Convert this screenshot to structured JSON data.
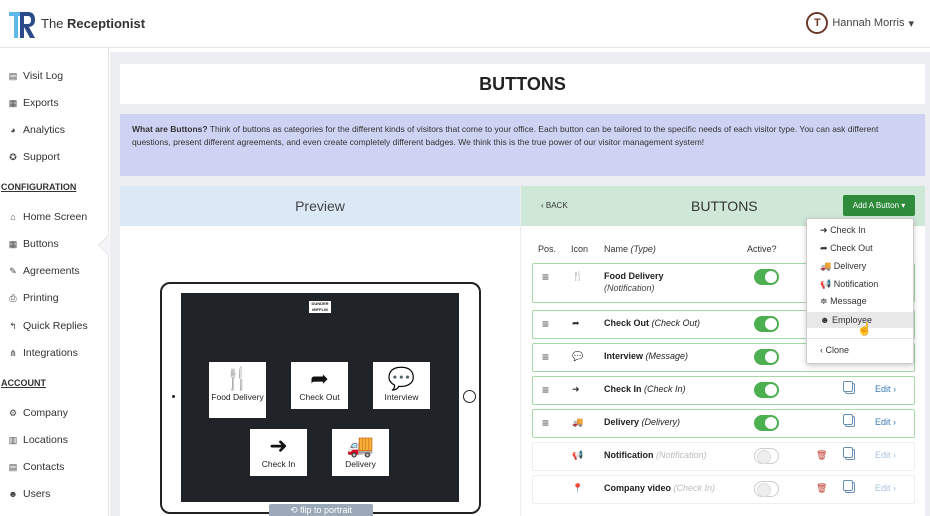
{
  "app": {
    "brand_light": "The ",
    "brand_bold": "Receptionist",
    "logo_letters": "R"
  },
  "user": {
    "name": "Hannah Morris",
    "avatar_initials": "T",
    "caret": "▾"
  },
  "sidebar": {
    "items": [
      {
        "icon": "file-icon",
        "glyph": "▤",
        "label": "Visit Log"
      },
      {
        "icon": "calendar-icon",
        "glyph": "▦",
        "label": "Exports"
      },
      {
        "icon": "tachometer-icon",
        "glyph": "◕",
        "label": "Analytics"
      },
      {
        "icon": "lifebuoy-icon",
        "glyph": "✪",
        "label": "Support"
      }
    ],
    "config_heading": "CONFIGURATION",
    "config_items": [
      {
        "icon": "home-icon",
        "glyph": "⌂",
        "label": "Home Screen"
      },
      {
        "icon": "th-large-icon",
        "glyph": "▦",
        "label": "Buttons"
      },
      {
        "icon": "clipboard-icon",
        "glyph": "✎",
        "label": "Agreements"
      },
      {
        "icon": "print-icon",
        "glyph": "⎙",
        "label": "Printing"
      },
      {
        "icon": "reply-icon",
        "glyph": "↰",
        "label": "Quick Replies"
      },
      {
        "icon": "sitemap-icon",
        "glyph": "⋔",
        "label": "Integrations"
      }
    ],
    "account_heading": "ACCOUNT",
    "account_items": [
      {
        "icon": "cog-icon",
        "glyph": "⚙",
        "label": "Company"
      },
      {
        "icon": "building-icon",
        "glyph": "▥",
        "label": "Locations"
      },
      {
        "icon": "address-book-icon",
        "glyph": "▤",
        "label": "Contacts"
      },
      {
        "icon": "users-icon",
        "glyph": "☻",
        "label": "Users"
      }
    ]
  },
  "page": {
    "title": "BUTTONS",
    "info_bold": "What are Buttons?",
    "info_text": " Think of buttons as categories for the different kinds of visitors that come to your office. Each button can be tailored to the specific needs of each visitor type. You can ask different questions, present different agreements, and even create completely different badges. We think this is the true power of our visitor management system!"
  },
  "preview": {
    "heading": "Preview",
    "logo_text": "DUNDER MIFFLIN",
    "buttons": [
      {
        "icon": "cutlery-icon",
        "glyph": "🍴",
        "label": "Food Delivery"
      },
      {
        "icon": "sign-out-icon",
        "glyph": "➦",
        "label": "Check Out"
      },
      {
        "icon": "comments-icon",
        "glyph": "💬",
        "label": "Interview"
      },
      {
        "icon": "sign-in-icon",
        "glyph": "➜",
        "label": "Check In"
      },
      {
        "icon": "truck-icon",
        "glyph": "🚚",
        "label": "Delivery"
      }
    ],
    "flip_label": "⟲ flip to portrait"
  },
  "buttons_panel": {
    "back_label": "‹ BACK",
    "title": "BUTTONS",
    "add_label": "Add A Button ▾",
    "columns": {
      "pos": "Pos.",
      "icon": "Icon",
      "name": "Name ",
      "type": "(Type)",
      "active": "Active?"
    },
    "rows": [
      {
        "glyph": "🍴",
        "icon": "cutlery-icon",
        "name": "Food Delivery",
        "type": "(Notification)",
        "active": true,
        "type_on_second_line": true
      },
      {
        "glyph": "➦",
        "icon": "sign-out-icon",
        "name": "Check Out",
        "type": "(Check Out)",
        "active": true
      },
      {
        "glyph": "💬",
        "icon": "comments-icon",
        "name": "Interview",
        "type": "(Message)",
        "active": true
      },
      {
        "glyph": "➜",
        "icon": "sign-in-icon",
        "name": "Check In",
        "type": "(Check In)",
        "active": true
      },
      {
        "glyph": "🚚",
        "icon": "truck-icon",
        "name": "Delivery",
        "type": "(Delivery)",
        "active": true
      },
      {
        "glyph": "📢",
        "icon": "bullhorn-icon",
        "name": "Notification",
        "type": "(Notification)",
        "active": false
      },
      {
        "glyph": "📍",
        "icon": "map-pin-icon",
        "name": "Company video",
        "type": "(Check In)",
        "active": false
      }
    ],
    "edit_label": "Edit ›"
  },
  "dropdown": {
    "items": [
      {
        "glyph": "➜",
        "label": "Check In"
      },
      {
        "glyph": "➦",
        "label": "Check Out"
      },
      {
        "glyph": "🚚",
        "label": "Delivery"
      },
      {
        "glyph": "📢",
        "label": "Notification"
      },
      {
        "glyph": "≑",
        "label": "Message"
      },
      {
        "glyph": "☻",
        "label": "Employee",
        "highlighted": true
      }
    ],
    "clone_label": "‹ Clone"
  }
}
